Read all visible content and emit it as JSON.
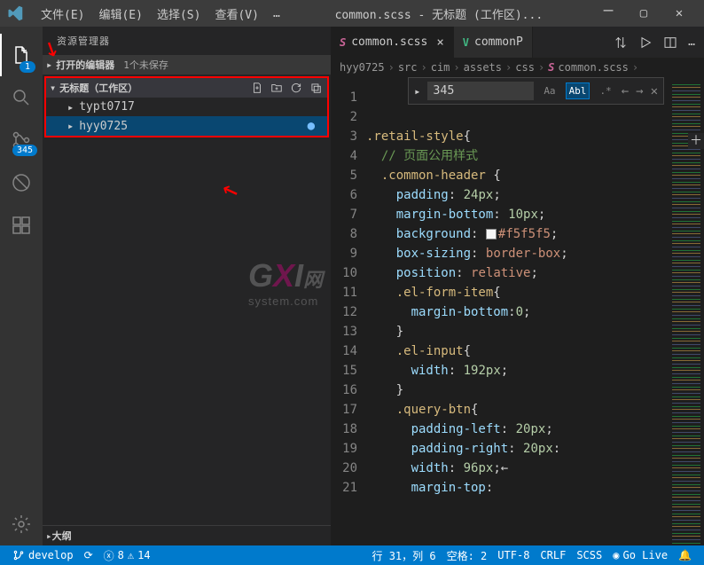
{
  "titlebar": {
    "menu": {
      "file": "文件(E)",
      "edit": "编辑(E)",
      "select": "选择(S)",
      "view": "查看(V)",
      "more": "…"
    },
    "title": "common.scss - 无标题 (工作区)..."
  },
  "activity": {
    "explorer_badge": "1",
    "scm_badge": "345"
  },
  "sidebar": {
    "title": "资源管理器",
    "open_editors_label": "打开的编辑器",
    "open_editors_note": "1个未保存",
    "workspace_label": "无标题（工作区）",
    "folders": [
      {
        "name": "typt0717",
        "selected": false
      },
      {
        "name": "hyy0725",
        "selected": true
      }
    ],
    "outline_label": "大纲"
  },
  "tabs": {
    "active": {
      "label": "common.scss"
    },
    "second": {
      "label": "commonP"
    },
    "close": "×"
  },
  "breadcrumb": [
    "hyy0725",
    "src",
    "cim",
    "assets",
    "css",
    "common.scss"
  ],
  "find": {
    "value": "345",
    "opts": {
      "case": "Aa",
      "word": "Abl",
      "regex": ".*"
    },
    "prev": "←",
    "next": "→",
    "close": "✕"
  },
  "code": {
    "start_line": 1,
    "lines": [
      {
        "html": ""
      },
      {
        "html": ""
      },
      {
        "html": "<span class='sel'>.retail-style</span><span class='pun'>{</span>"
      },
      {
        "html": "  <span class='cmt'>// 页面公用样式</span>"
      },
      {
        "html": "  <span class='sel'>.common-header</span> <span class='pun'>{</span>"
      },
      {
        "html": "    <span class='prop'>padding</span><span class='op'>:</span> <span class='num'>24px</span><span class='pun'>;</span>"
      },
      {
        "html": "    <span class='prop'>margin-bottom</span><span class='op'>:</span> <span class='num'>10px</span><span class='pun'>;</span>"
      },
      {
        "html": "    <span class='prop'>background</span><span class='op'>:</span> <span class='hexbox'></span><span class='val'>#f5f5f5</span><span class='pun'>;</span>"
      },
      {
        "html": "    <span class='prop'>box-sizing</span><span class='op'>:</span> <span class='val'>border-box</span><span class='pun'>;</span>"
      },
      {
        "html": "    <span class='prop'>position</span><span class='op'>:</span> <span class='val'>relative</span><span class='pun'>;</span>"
      },
      {
        "html": "    <span class='sel'>.el-form-item</span><span class='pun'>{</span>"
      },
      {
        "html": "      <span class='prop'>margin-bottom</span><span class='op'>:</span><span class='num'>0</span><span class='pun'>;</span>"
      },
      {
        "html": "    <span class='pun'>}</span>"
      },
      {
        "html": "    <span class='sel'>.el-input</span><span class='pun'>{</span>"
      },
      {
        "html": "      <span class='prop'>width</span><span class='op'>:</span> <span class='num'>192px</span><span class='pun'>;</span>"
      },
      {
        "html": "    <span class='pun'>}</span>"
      },
      {
        "html": "    <span class='sel'>.query-btn</span><span class='pun'>{</span>"
      },
      {
        "html": "      <span class='prop'>padding-left</span><span class='op'>:</span> <span class='num'>20px</span><span class='pun'>;</span>"
      },
      {
        "html": "      <span class='prop'>padding-right</span><span class='op'>:</span> <span class='num'>20px</span><span class='pun'>:</span>"
      },
      {
        "html": "      <span class='prop'>width</span><span class='op'>:</span> <span class='num'>96px</span><span class='pun'>;</span><span class='op'>←</span>"
      },
      {
        "html": "      <span class='prop'>margin-top</span><span class='op'>:</span>"
      }
    ]
  },
  "statusbar": {
    "branch": "develop",
    "sync": "⟳",
    "errors": "8",
    "warnings": "14",
    "loc": "行 31，列 6",
    "spaces": "空格: 2",
    "encoding": "UTF-8",
    "eol": "CRLF",
    "lang": "SCSS",
    "golive": "Go Live",
    "bell": "🔔"
  },
  "watermark": {
    "g": "G",
    "x": "X",
    "i": "I",
    "sub": "system.com",
    "wang": "网"
  }
}
